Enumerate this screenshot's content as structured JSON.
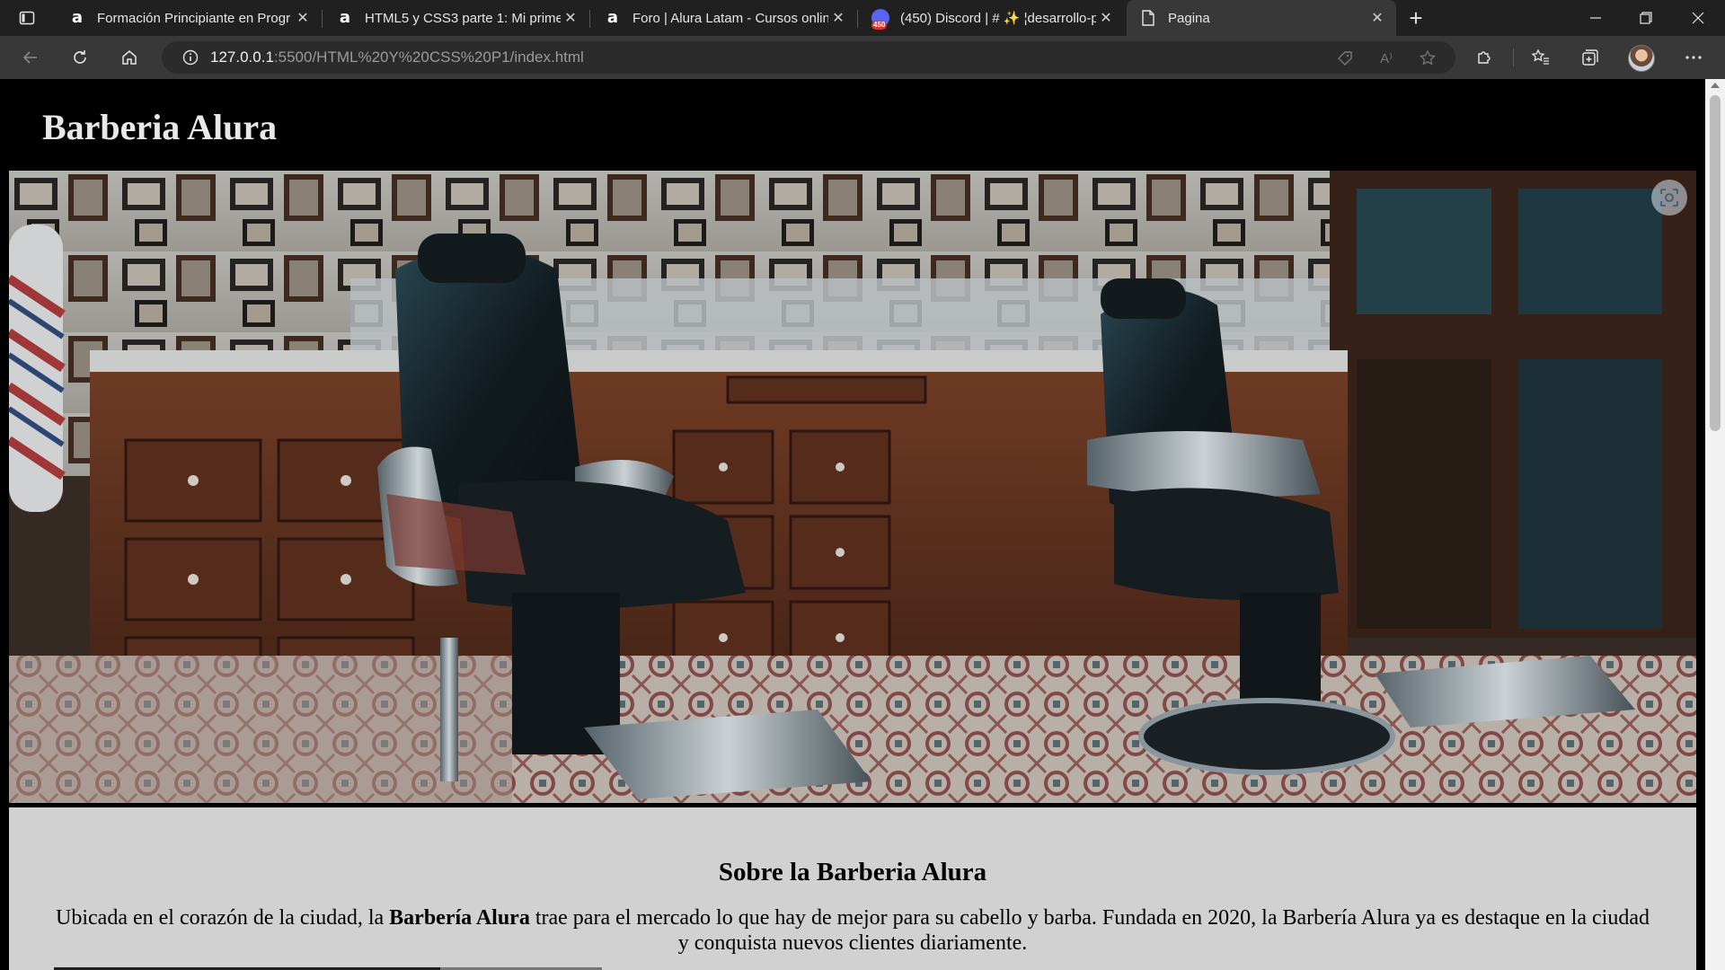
{
  "browser": {
    "tabs": [
      {
        "title": "Formación Principiante en Progr",
        "icon": "alura-icon",
        "active": false
      },
      {
        "title": "HTML5 y CSS3 parte 1: Mi primer",
        "icon": "alura-icon",
        "active": false
      },
      {
        "title": "Foro | Alura Latam - Cursos onlin",
        "icon": "alura-icon",
        "active": false
      },
      {
        "title": "(450) Discord | # ✨ ¦desarrollo-p",
        "icon": "discord-icon",
        "badge": "450",
        "active": false
      },
      {
        "title": "Pagina",
        "icon": "page-icon",
        "active": true
      }
    ],
    "new_tab_label": "+",
    "address": {
      "host": "127.0.0.1",
      "path": ":5500/HTML%20Y%20CSS%20P1/index.html"
    },
    "read_aloud_label": "A⁾"
  },
  "page": {
    "site_title": "Barberia Alura",
    "banner_alt": "Barbería",
    "about": {
      "heading": "Sobre la Barberia Alura",
      "text_before": "Ubicada en el corazón de la ciudad, la ",
      "text_bold": "Barbería Alura",
      "text_after": " trae para el mercado lo que hay de mejor para su cabello y barba. Fundada en 2020, la Barbería Alura ya es destaque en la ciudad y conquista nuevos clientes diariamente."
    }
  },
  "colors": {
    "chrome_dark": "#202020",
    "chrome_toolbar": "#383838",
    "page_header": "#000000",
    "about_bg": "#d1d1d1"
  }
}
